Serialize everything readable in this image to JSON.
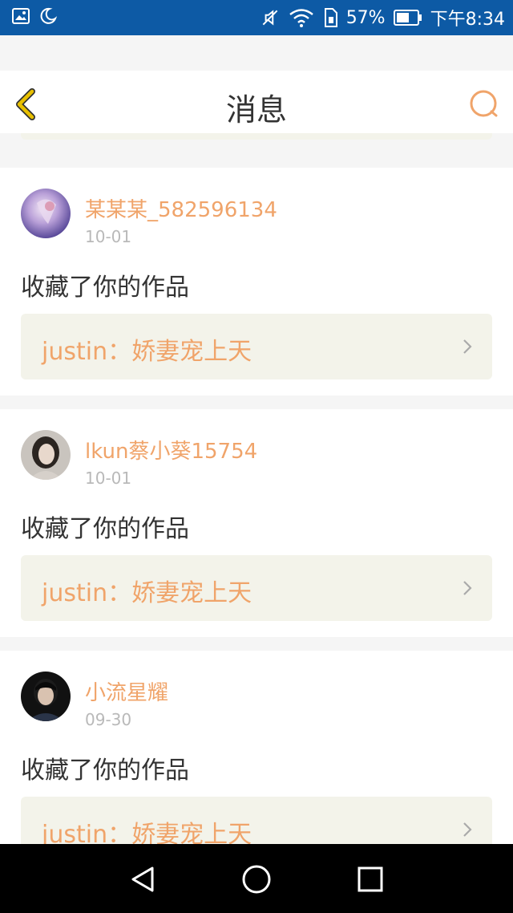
{
  "status_bar": {
    "battery": "57%",
    "time": "下午8:34",
    "icons": [
      "gallery-icon",
      "moon-icon",
      "mute-icon",
      "wifi-icon",
      "sim-icon",
      "battery-icon"
    ]
  },
  "header": {
    "title": "消息",
    "back_icon": "chevron-left-icon",
    "search_icon": "search-icon",
    "accent": "#f0a46a",
    "back_color": "#e8c000"
  },
  "messages": [
    {
      "username": "某某某_582596134",
      "date": "10-01",
      "action": "收藏了你的作品",
      "work": "justin：娇妻宠上天"
    },
    {
      "username": "lkun蔡小葵15754",
      "date": "10-01",
      "action": "收藏了你的作品",
      "work": "justin：娇妻宠上天"
    },
    {
      "username": "小流星耀",
      "date": "09-30",
      "action": "收藏了你的作品",
      "work": "justin：娇妻宠上天"
    }
  ],
  "nav_bar": {
    "icons": [
      "back-triangle-icon",
      "home-circle-icon",
      "recents-square-icon"
    ]
  }
}
